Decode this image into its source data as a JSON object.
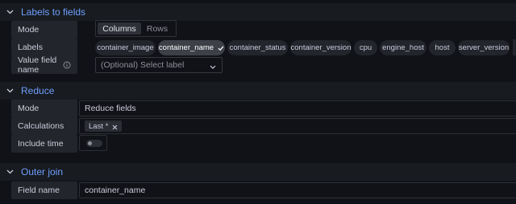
{
  "labels_to_fields": {
    "title": "Labels to fields",
    "mode_label": "Mode",
    "mode_options": [
      "Columns",
      "Rows"
    ],
    "mode_selected": "Columns",
    "labels_label": "Labels",
    "label_chips": [
      "container_image",
      "container_name",
      "container_status",
      "container_version",
      "cpu",
      "engine_host",
      "host",
      "server_version"
    ],
    "selected_label": "container_name",
    "value_field_label": "Value field name",
    "value_field_placeholder": "(Optional) Select label"
  },
  "reduce": {
    "title": "Reduce",
    "mode_label": "Mode",
    "mode_value": "Reduce fields",
    "calculations_label": "Calculations",
    "calculations_tags": [
      "Last *"
    ],
    "include_time_label": "Include time",
    "include_time_enabled": false
  },
  "outer_join": {
    "title": "Outer join",
    "field_name_label": "Field name",
    "field_name_value": "container_name"
  },
  "colors": {
    "background": "#111217",
    "section_header": "#181b1f",
    "accent_title": "#6e9fff",
    "label_cell": "#22252b"
  },
  "icons": {
    "section_toggle": "chevron-down-icon",
    "info": "info-circle-icon",
    "check": "check-icon",
    "remove": "close-icon",
    "dropdown": "caret-down-icon"
  }
}
